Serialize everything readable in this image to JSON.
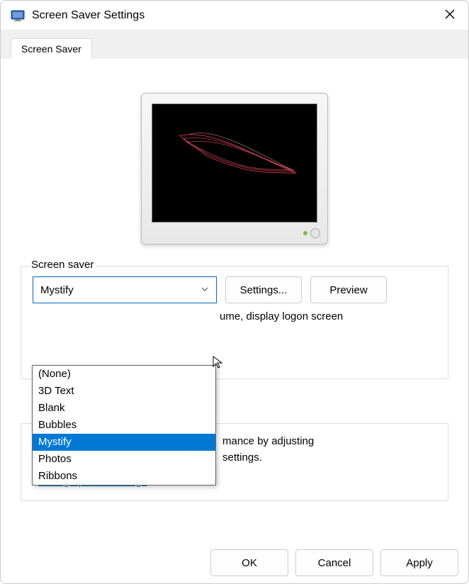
{
  "window": {
    "title": "Screen Saver Settings"
  },
  "tab": {
    "label": "Screen Saver"
  },
  "section": {
    "legend": "Screen saver"
  },
  "combo": {
    "selected": "Mystify"
  },
  "buttons": {
    "settings": "Settings...",
    "preview": "Preview"
  },
  "options": [
    "(None)",
    "3D Text",
    "Blank",
    "Bubbles",
    "Mystify",
    "Photos",
    "Ribbons"
  ],
  "selected_option_index": 4,
  "hint1": "ume, display logon screen",
  "hint2_line1": "mance by adjusting",
  "hint2_line2": "settings.",
  "link": "Change power settings",
  "footer": {
    "ok": "OK",
    "cancel": "Cancel",
    "apply": "Apply"
  }
}
